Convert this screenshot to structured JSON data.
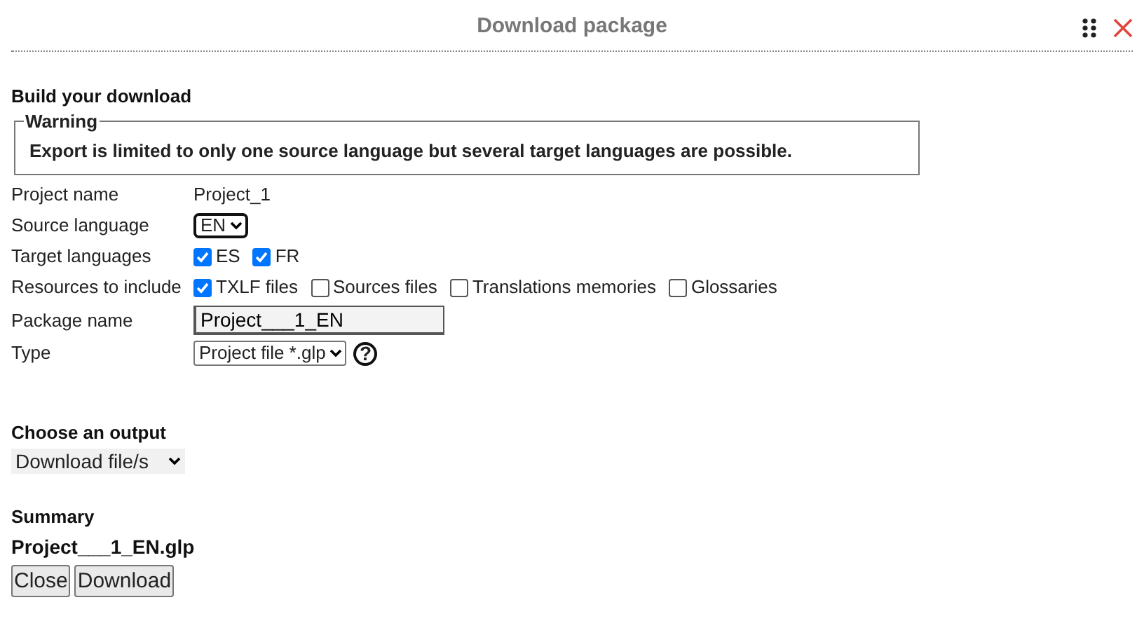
{
  "dialog": {
    "title": "Download package"
  },
  "build": {
    "heading": "Build your download",
    "warning": {
      "legend": "Warning",
      "text": "Export is limited to only one source language but several target languages are possible."
    },
    "fields": [
      {
        "kind": "text",
        "label": "Project name",
        "value": "Project_1"
      },
      {
        "kind": "select",
        "label": "Source language",
        "value": "EN",
        "focused": true
      },
      {
        "kind": "checks",
        "label": "Target languages",
        "options": [
          {
            "label": "ES",
            "checked": true
          },
          {
            "label": "FR",
            "checked": true
          }
        ]
      },
      {
        "kind": "checks",
        "label": "Resources to include",
        "options": [
          {
            "label": "TXLF files",
            "checked": true
          },
          {
            "label": "Sources files",
            "checked": false
          },
          {
            "label": "Translations memories",
            "checked": false
          },
          {
            "label": "Glossaries",
            "checked": false
          }
        ]
      },
      {
        "kind": "input",
        "label": "Package name",
        "value": "Project___1_EN"
      },
      {
        "kind": "select",
        "label": "Type",
        "value": "Project file *.glp",
        "focused": false,
        "help": "?"
      }
    ]
  },
  "output": {
    "heading": "Choose an output",
    "value": "Download file/s"
  },
  "summary": {
    "heading": "Summary",
    "filename": "Project___1_EN.glp"
  },
  "buttons": [
    "Close",
    "Download"
  ]
}
